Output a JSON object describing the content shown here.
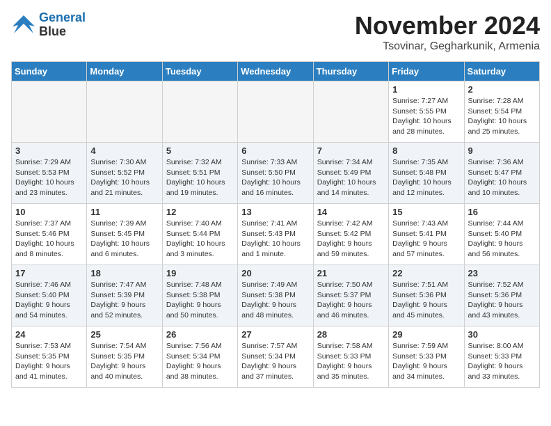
{
  "header": {
    "logo_line1": "General",
    "logo_line2": "Blue",
    "month": "November 2024",
    "location": "Tsovinar, Gegharkunik, Armenia"
  },
  "weekdays": [
    "Sunday",
    "Monday",
    "Tuesday",
    "Wednesday",
    "Thursday",
    "Friday",
    "Saturday"
  ],
  "weeks": [
    [
      {
        "day": "",
        "info": "",
        "empty": true
      },
      {
        "day": "",
        "info": "",
        "empty": true
      },
      {
        "day": "",
        "info": "",
        "empty": true
      },
      {
        "day": "",
        "info": "",
        "empty": true
      },
      {
        "day": "",
        "info": "",
        "empty": true
      },
      {
        "day": "1",
        "info": "Sunrise: 7:27 AM\nSunset: 5:55 PM\nDaylight: 10 hours\nand 28 minutes.",
        "empty": false
      },
      {
        "day": "2",
        "info": "Sunrise: 7:28 AM\nSunset: 5:54 PM\nDaylight: 10 hours\nand 25 minutes.",
        "empty": false
      }
    ],
    [
      {
        "day": "3",
        "info": "Sunrise: 7:29 AM\nSunset: 5:53 PM\nDaylight: 10 hours\nand 23 minutes.",
        "empty": false
      },
      {
        "day": "4",
        "info": "Sunrise: 7:30 AM\nSunset: 5:52 PM\nDaylight: 10 hours\nand 21 minutes.",
        "empty": false
      },
      {
        "day": "5",
        "info": "Sunrise: 7:32 AM\nSunset: 5:51 PM\nDaylight: 10 hours\nand 19 minutes.",
        "empty": false
      },
      {
        "day": "6",
        "info": "Sunrise: 7:33 AM\nSunset: 5:50 PM\nDaylight: 10 hours\nand 16 minutes.",
        "empty": false
      },
      {
        "day": "7",
        "info": "Sunrise: 7:34 AM\nSunset: 5:49 PM\nDaylight: 10 hours\nand 14 minutes.",
        "empty": false
      },
      {
        "day": "8",
        "info": "Sunrise: 7:35 AM\nSunset: 5:48 PM\nDaylight: 10 hours\nand 12 minutes.",
        "empty": false
      },
      {
        "day": "9",
        "info": "Sunrise: 7:36 AM\nSunset: 5:47 PM\nDaylight: 10 hours\nand 10 minutes.",
        "empty": false
      }
    ],
    [
      {
        "day": "10",
        "info": "Sunrise: 7:37 AM\nSunset: 5:46 PM\nDaylight: 10 hours\nand 8 minutes.",
        "empty": false
      },
      {
        "day": "11",
        "info": "Sunrise: 7:39 AM\nSunset: 5:45 PM\nDaylight: 10 hours\nand 6 minutes.",
        "empty": false
      },
      {
        "day": "12",
        "info": "Sunrise: 7:40 AM\nSunset: 5:44 PM\nDaylight: 10 hours\nand 3 minutes.",
        "empty": false
      },
      {
        "day": "13",
        "info": "Sunrise: 7:41 AM\nSunset: 5:43 PM\nDaylight: 10 hours\nand 1 minute.",
        "empty": false
      },
      {
        "day": "14",
        "info": "Sunrise: 7:42 AM\nSunset: 5:42 PM\nDaylight: 9 hours\nand 59 minutes.",
        "empty": false
      },
      {
        "day": "15",
        "info": "Sunrise: 7:43 AM\nSunset: 5:41 PM\nDaylight: 9 hours\nand 57 minutes.",
        "empty": false
      },
      {
        "day": "16",
        "info": "Sunrise: 7:44 AM\nSunset: 5:40 PM\nDaylight: 9 hours\nand 56 minutes.",
        "empty": false
      }
    ],
    [
      {
        "day": "17",
        "info": "Sunrise: 7:46 AM\nSunset: 5:40 PM\nDaylight: 9 hours\nand 54 minutes.",
        "empty": false
      },
      {
        "day": "18",
        "info": "Sunrise: 7:47 AM\nSunset: 5:39 PM\nDaylight: 9 hours\nand 52 minutes.",
        "empty": false
      },
      {
        "day": "19",
        "info": "Sunrise: 7:48 AM\nSunset: 5:38 PM\nDaylight: 9 hours\nand 50 minutes.",
        "empty": false
      },
      {
        "day": "20",
        "info": "Sunrise: 7:49 AM\nSunset: 5:38 PM\nDaylight: 9 hours\nand 48 minutes.",
        "empty": false
      },
      {
        "day": "21",
        "info": "Sunrise: 7:50 AM\nSunset: 5:37 PM\nDaylight: 9 hours\nand 46 minutes.",
        "empty": false
      },
      {
        "day": "22",
        "info": "Sunrise: 7:51 AM\nSunset: 5:36 PM\nDaylight: 9 hours\nand 45 minutes.",
        "empty": false
      },
      {
        "day": "23",
        "info": "Sunrise: 7:52 AM\nSunset: 5:36 PM\nDaylight: 9 hours\nand 43 minutes.",
        "empty": false
      }
    ],
    [
      {
        "day": "24",
        "info": "Sunrise: 7:53 AM\nSunset: 5:35 PM\nDaylight: 9 hours\nand 41 minutes.",
        "empty": false
      },
      {
        "day": "25",
        "info": "Sunrise: 7:54 AM\nSunset: 5:35 PM\nDaylight: 9 hours\nand 40 minutes.",
        "empty": false
      },
      {
        "day": "26",
        "info": "Sunrise: 7:56 AM\nSunset: 5:34 PM\nDaylight: 9 hours\nand 38 minutes.",
        "empty": false
      },
      {
        "day": "27",
        "info": "Sunrise: 7:57 AM\nSunset: 5:34 PM\nDaylight: 9 hours\nand 37 minutes.",
        "empty": false
      },
      {
        "day": "28",
        "info": "Sunrise: 7:58 AM\nSunset: 5:33 PM\nDaylight: 9 hours\nand 35 minutes.",
        "empty": false
      },
      {
        "day": "29",
        "info": "Sunrise: 7:59 AM\nSunset: 5:33 PM\nDaylight: 9 hours\nand 34 minutes.",
        "empty": false
      },
      {
        "day": "30",
        "info": "Sunrise: 8:00 AM\nSunset: 5:33 PM\nDaylight: 9 hours\nand 33 minutes.",
        "empty": false
      }
    ]
  ]
}
